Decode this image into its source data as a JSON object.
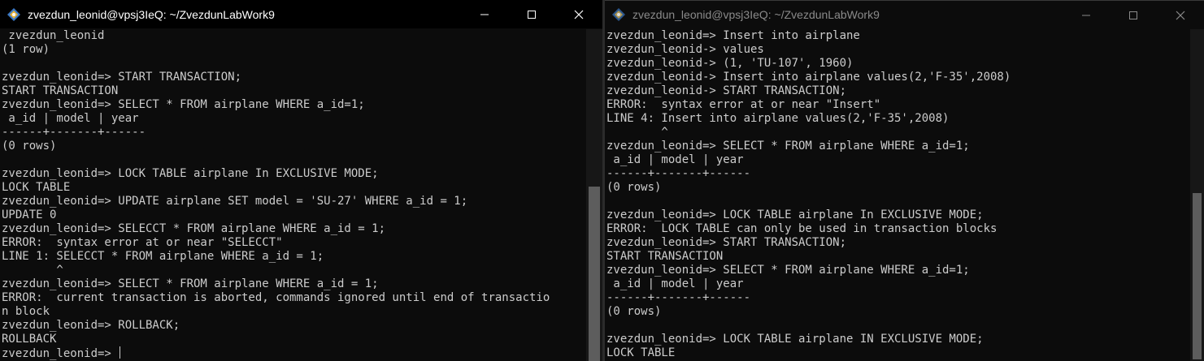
{
  "left": {
    "title": "zvezdun_leonid@vpsj3IeQ: ~/ZvezdunLabWork9",
    "icon": "tux-kali-icon",
    "controls": {
      "minimize": "minimize-icon",
      "maximize": "maximize-icon",
      "close": "close-icon"
    },
    "lines": [
      " zvezdun_leonid",
      "(1 row)",
      "",
      "zvezdun_leonid=> START TRANSACTION;",
      "START TRANSACTION",
      "zvezdun_leonid=> SELECT * FROM airplane WHERE a_id=1;",
      " a_id | model | year",
      "------+-------+------",
      "(0 rows)",
      "",
      "zvezdun_leonid=> LOCK TABLE airplane In EXCLUSIVE MODE;",
      "LOCK TABLE",
      "zvezdun_leonid=> UPDATE airplane SET model = 'SU-27' WHERE a_id = 1;",
      "UPDATE 0",
      "zvezdun_leonid=> SELECCT * FROM airplane WHERE a_id = 1;",
      "ERROR:  syntax error at or near \"SELECCT\"",
      "LINE 1: SELECCT * FROM airplane WHERE a_id = 1;",
      "        ^",
      "zvezdun_leonid=> SELECT * FROM airplane WHERE a_id = 1;",
      "ERROR:  current transaction is aborted, commands ignored until end of transactio",
      "n block",
      "zvezdun_leonid=> ROLLBACK;",
      "ROLLBACK"
    ],
    "prompt": "zvezdun_leonid=> "
  },
  "right": {
    "title": "zvezdun_leonid@vpsj3IeQ: ~/ZvezdunLabWork9",
    "icon": "tux-kali-icon",
    "controls": {
      "minimize": "minimize-icon",
      "maximize": "maximize-icon",
      "close": "close-icon"
    },
    "lines": [
      "zvezdun_leonid=> Insert into airplane",
      "zvezdun_leonid-> values",
      "zvezdun_leonid-> (1, 'TU-107', 1960)",
      "zvezdun_leonid-> Insert into airplane values(2,'F-35',2008)",
      "zvezdun_leonid-> START TRANSACTION;",
      "ERROR:  syntax error at or near \"Insert\"",
      "LINE 4: Insert into airplane values(2,'F-35',2008)",
      "        ^",
      "zvezdun_leonid=> SELECT * FROM airplane WHERE a_id=1;",
      " a_id | model | year",
      "------+-------+------",
      "(0 rows)",
      "",
      "zvezdun_leonid=> LOCK TABLE airplane In EXCLUSIVE MODE;",
      "ERROR:  LOCK TABLE can only be used in transaction blocks",
      "zvezdun_leonid=> START TRANSACTION;",
      "START TRANSACTION",
      "zvezdun_leonid=> SELECT * FROM airplane WHERE a_id=1;",
      " a_id | model | year",
      "------+-------+------",
      "(0 rows)",
      "",
      "zvezdun_leonid=> LOCK TABLE airplane IN EXCLUSIVE MODE;",
      "LOCK TABLE"
    ]
  }
}
